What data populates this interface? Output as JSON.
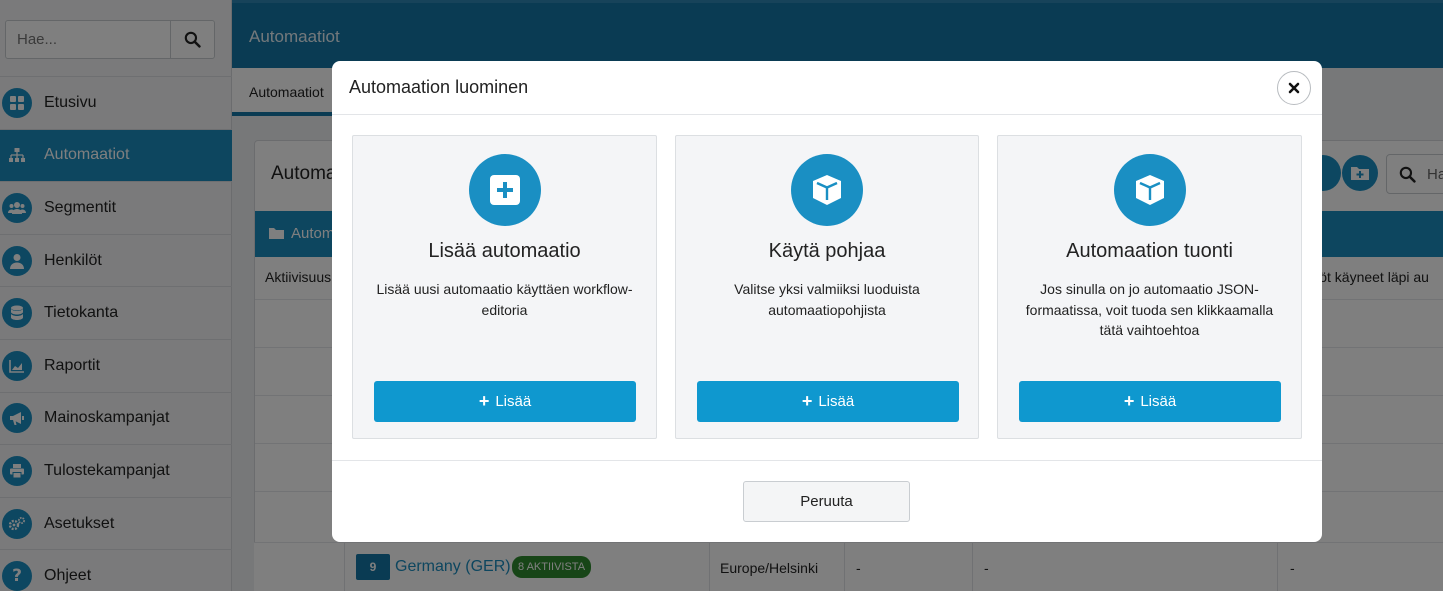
{
  "sidebar": {
    "search_placeholder": "Hae...",
    "items": [
      {
        "label": "Etusivu",
        "icon": "dashboard-icon"
      },
      {
        "label": "Automaatiot",
        "icon": "sitemap-icon",
        "active": true
      },
      {
        "label": "Segmentit",
        "icon": "users-icon"
      },
      {
        "label": "Henkilöt",
        "icon": "user-icon"
      },
      {
        "label": "Tietokanta",
        "icon": "database-icon"
      },
      {
        "label": "Raportit",
        "icon": "chart-icon"
      },
      {
        "label": "Mainoskampanjat",
        "icon": "megaphone-icon"
      },
      {
        "label": "Tulostekampanjat",
        "icon": "printer-icon"
      },
      {
        "label": "Asetukset",
        "icon": "gears-icon"
      },
      {
        "label": "Ohjeet",
        "icon": "question-icon"
      }
    ]
  },
  "header": {
    "title": "Automaatiot"
  },
  "tabs": [
    {
      "label": "Automaatiot"
    }
  ],
  "panel": {
    "title": "Automa",
    "head_label": "Autom",
    "col_left": "Aktiivisuus",
    "col_right": "ilöt käyneet läpi au",
    "search_placeholder": "Ha"
  },
  "row": {
    "folder_number": "9",
    "name": "Germany (GER)",
    "badge": "8 AKTIIVISTA",
    "timezone": "Europe/Helsinki",
    "dash": "-"
  },
  "modal": {
    "title": "Automaation luominen",
    "cards": [
      {
        "title": "Lisää automaatio",
        "desc": "Lisää uusi automaatio käyttäen workflow-editoria",
        "button": "Lisää",
        "icon": "plus-square-icon"
      },
      {
        "title": "Käytä pohjaa",
        "desc": "Valitse yksi valmiiksi luoduista automaatiopohjista",
        "button": "Lisää",
        "icon": "cube-icon"
      },
      {
        "title": "Automaation tuonti",
        "desc": "Jos sinulla on jo automaatio JSON-formaatissa, voit tuoda sen klikkaamalla tätä vaihtoehtoa",
        "button": "Lisää",
        "icon": "cube-icon"
      }
    ],
    "cancel": "Peruuta"
  },
  "colors": {
    "primary": "#1b8cbe",
    "header": "#1577a6",
    "success": "#2e8b2e"
  }
}
